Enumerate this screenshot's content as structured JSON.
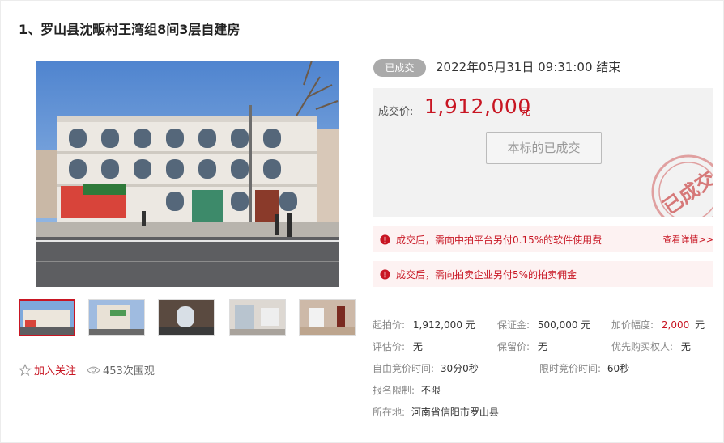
{
  "title": "1、罗山县沈畈村王湾组8间3层自建房",
  "status": {
    "badge": "已成交",
    "end_time": "2022年05月31日  09:31:00 结束"
  },
  "price": {
    "label": "成交价:",
    "value": "1,912,000",
    "unit": "元",
    "button": "本标的已成交",
    "stamp": "已成交"
  },
  "notices": [
    {
      "text": "成交后，需向中拍平台另付0.15%的软件使用费",
      "link": "查看详情>>"
    },
    {
      "text": "成交后，需向拍卖企业另付5%的拍卖佣金"
    }
  ],
  "actions": {
    "follow": "加入关注",
    "views": "453次围观"
  },
  "details": {
    "start_price_k": "起拍价:",
    "start_price_v": "1,912,000 元",
    "deposit_k": "保证金:",
    "deposit_v": "500,000 元",
    "increment_k": "加价幅度:",
    "increment_v": "2,000",
    "increment_unit": "元",
    "appraise_k": "评估价:",
    "appraise_v": "无",
    "reserve_k": "保留价:",
    "reserve_v": "无",
    "priority_k": "优先购买权人:",
    "priority_v": "无",
    "free_bid_k": "自由竞价时间:",
    "free_bid_v": "30分0秒",
    "limit_bid_k": "限时竞价时间:",
    "limit_bid_v": "60秒",
    "signup_k": "报名限制:",
    "signup_v": "不限",
    "location_k": "所在地:",
    "location_v": "河南省信阳市罗山县"
  },
  "colors": {
    "accent": "#c81623",
    "badge": "#aaaaaa"
  }
}
